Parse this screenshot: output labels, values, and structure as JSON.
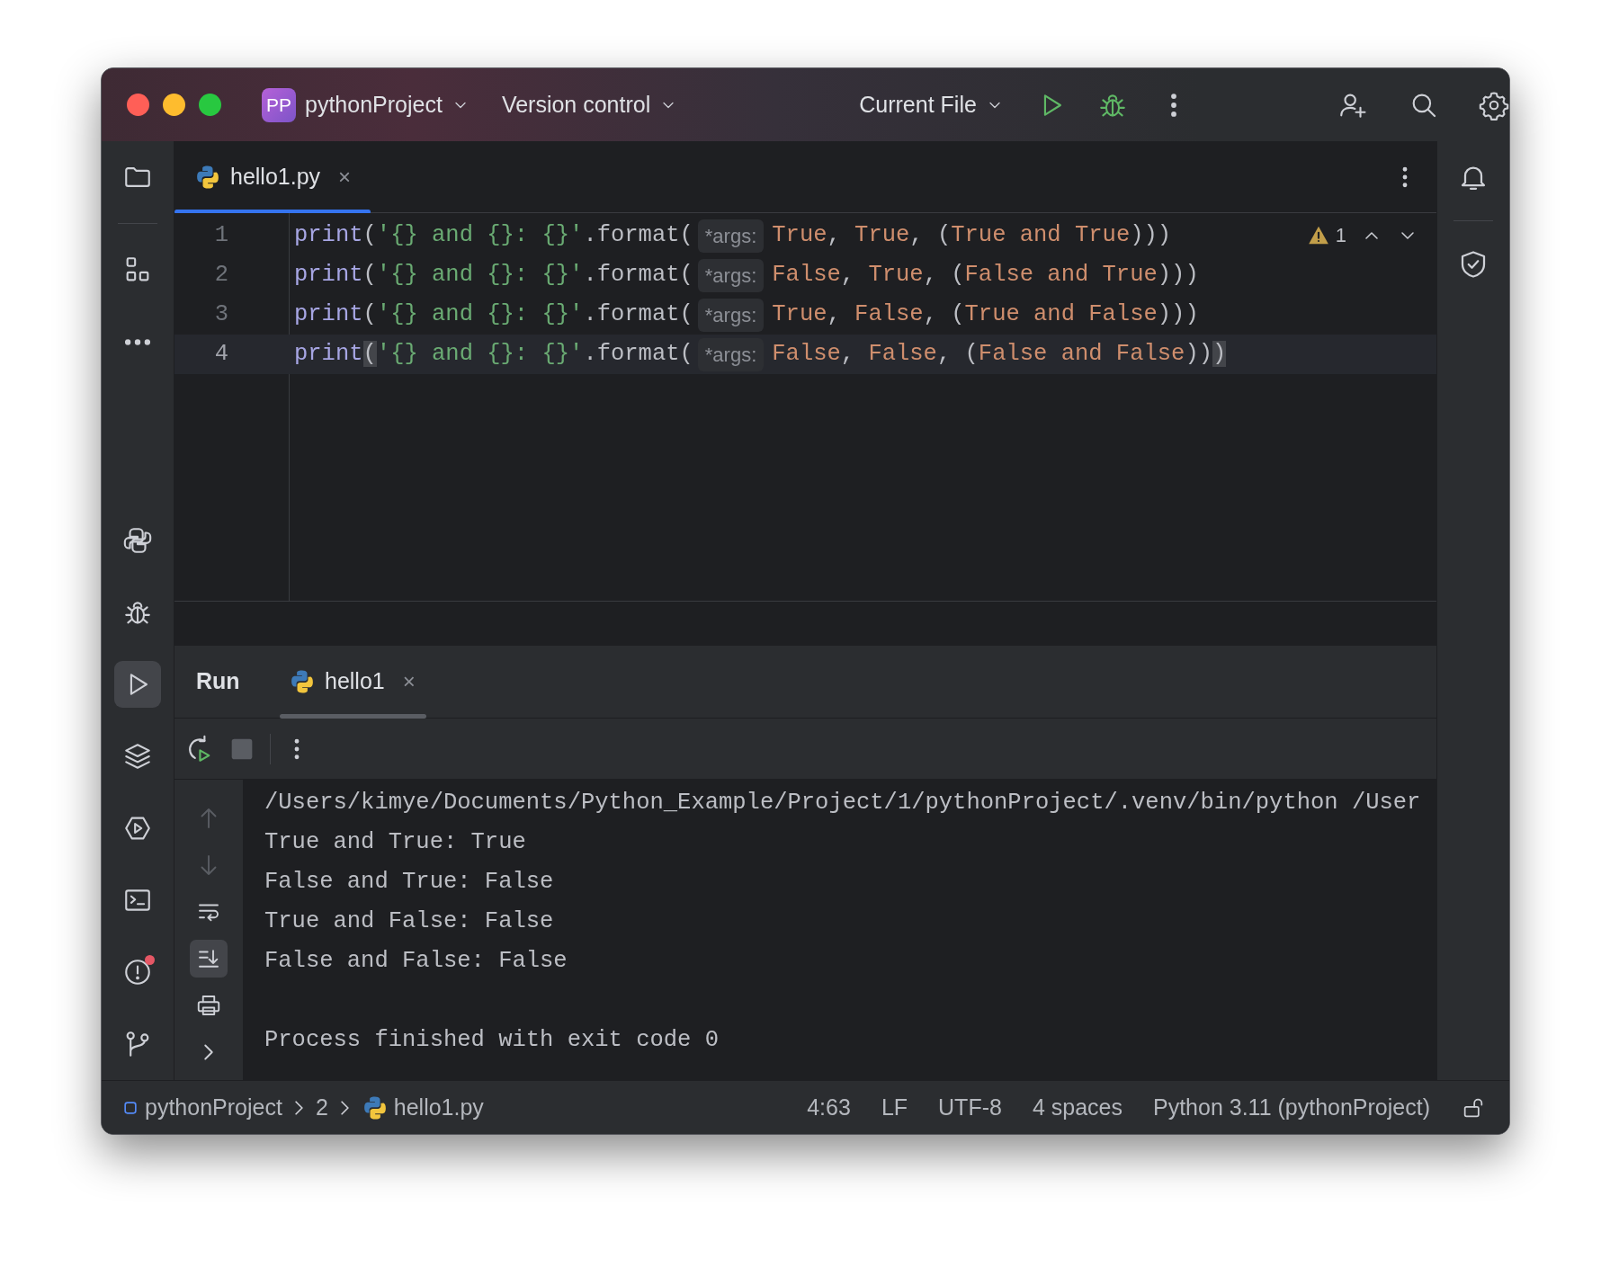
{
  "window": {
    "controls": [
      {
        "color": "#ff5f57"
      },
      {
        "color": "#febc2e"
      },
      {
        "color": "#28c840"
      }
    ]
  },
  "title_bar": {
    "project_badge": "PP",
    "project": "pythonProject",
    "vcs": "Version control",
    "run_config": "Current File"
  },
  "left_toolbar": {
    "top": [
      {
        "kind": "folder",
        "selected": false,
        "notification": false
      },
      {
        "kind": "structure",
        "selected": false,
        "notification": false
      },
      {
        "kind": "more",
        "selected": false,
        "notification": false
      }
    ],
    "bottom": [
      {
        "kind": "python",
        "selected": false,
        "notification": false
      },
      {
        "kind": "bug",
        "selected": false,
        "notification": false
      },
      {
        "kind": "run",
        "selected": true,
        "notification": false
      },
      {
        "kind": "layers",
        "selected": false,
        "notification": false
      },
      {
        "kind": "services",
        "selected": false,
        "notification": false
      },
      {
        "kind": "terminal",
        "selected": false,
        "notification": false
      },
      {
        "kind": "problems",
        "selected": false,
        "notification": true
      },
      {
        "kind": "branch",
        "selected": false,
        "notification": false
      }
    ]
  },
  "right_toolbar": [
    {
      "kind": "bell"
    },
    {
      "kind": "shield"
    }
  ],
  "editor": {
    "tabs": [
      {
        "title": "hello1.py",
        "selected": true,
        "close": "×"
      }
    ],
    "warnings": "1",
    "lines": [
      {
        "number": "1",
        "current": false,
        "tokens": [
          {
            "kind": "builtin",
            "text": "print"
          },
          {
            "kind": "plain",
            "text": "("
          },
          {
            "kind": "string",
            "text": "'{} and {}: {}'"
          },
          {
            "kind": "plain",
            "text": ".format("
          },
          {
            "kind": "hint",
            "text": "*args:"
          },
          {
            "kind": "keyword",
            "text": "True"
          },
          {
            "kind": "plain",
            "text": ", "
          },
          {
            "kind": "keyword",
            "text": "True"
          },
          {
            "kind": "plain",
            "text": ", ("
          },
          {
            "kind": "keyword",
            "text": "True and True"
          },
          {
            "kind": "plain",
            "text": ")))"
          }
        ]
      },
      {
        "number": "2",
        "current": false,
        "tokens": [
          {
            "kind": "builtin",
            "text": "print"
          },
          {
            "kind": "plain",
            "text": "("
          },
          {
            "kind": "string",
            "text": "'{} and {}: {}'"
          },
          {
            "kind": "plain",
            "text": ".format("
          },
          {
            "kind": "hint",
            "text": "*args:"
          },
          {
            "kind": "keyword",
            "text": "False"
          },
          {
            "kind": "plain",
            "text": ", "
          },
          {
            "kind": "keyword",
            "text": "True"
          },
          {
            "kind": "plain",
            "text": ", ("
          },
          {
            "kind": "keyword",
            "text": "False and True"
          },
          {
            "kind": "plain",
            "text": ")))"
          }
        ]
      },
      {
        "number": "3",
        "current": false,
        "tokens": [
          {
            "kind": "builtin",
            "text": "print"
          },
          {
            "kind": "plain",
            "text": "("
          },
          {
            "kind": "string",
            "text": "'{} and {}: {}'"
          },
          {
            "kind": "plain",
            "text": ".format("
          },
          {
            "kind": "hint",
            "text": "*args:"
          },
          {
            "kind": "keyword",
            "text": "True"
          },
          {
            "kind": "plain",
            "text": ", "
          },
          {
            "kind": "keyword",
            "text": "False"
          },
          {
            "kind": "plain",
            "text": ", ("
          },
          {
            "kind": "keyword",
            "text": "True and False"
          },
          {
            "kind": "plain",
            "text": ")))"
          }
        ]
      },
      {
        "number": "4",
        "current": true,
        "tokens": [
          {
            "kind": "builtin",
            "text": "print"
          },
          {
            "kind": "match",
            "text": "("
          },
          {
            "kind": "string",
            "text": "'{} and {}: {}'"
          },
          {
            "kind": "plain",
            "text": ".format("
          },
          {
            "kind": "hint",
            "text": "*args:"
          },
          {
            "kind": "keyword",
            "text": "False"
          },
          {
            "kind": "plain",
            "text": ", "
          },
          {
            "kind": "keyword",
            "text": "False"
          },
          {
            "kind": "plain",
            "text": ", ("
          },
          {
            "kind": "keyword",
            "text": "False and False"
          },
          {
            "kind": "plain",
            "text": "))"
          },
          {
            "kind": "match",
            "text": ")"
          }
        ]
      }
    ]
  },
  "run_panel": {
    "title": "Run",
    "tabs": [
      {
        "title": "hello1",
        "selected": true,
        "close": "×"
      }
    ],
    "toolbar": {
      "stop_disabled": true
    },
    "side_buttons": [
      {
        "kind": "up",
        "disabled": true,
        "on": false
      },
      {
        "kind": "down",
        "disabled": true,
        "on": false
      },
      {
        "kind": "wrap",
        "disabled": false,
        "on": false
      },
      {
        "kind": "scroll_end",
        "disabled": false,
        "on": true
      },
      {
        "kind": "print",
        "disabled": false,
        "on": false
      },
      {
        "kind": "expand",
        "disabled": false,
        "on": false
      }
    ],
    "output": [
      "/Users/kimye/Documents/Python_Example/Project/1/pythonProject/.venv/bin/python /User",
      "True and True: True",
      "False and True: False",
      "True and False: False",
      "False and False: False"
    ],
    "exit_message": "Process finished with exit code 0"
  },
  "status_bar": {
    "breadcrumbs": [
      {
        "kind": "project",
        "text": "pythonProject"
      },
      {
        "kind": "folder",
        "text": "2"
      },
      {
        "kind": "python_file",
        "text": "hello1.py"
      }
    ],
    "position": "4:63",
    "line_separator": "LF",
    "encoding": "UTF-8",
    "indent": "4 spaces",
    "interpreter": "Python 3.11 (pythonProject)",
    "read_only": false
  }
}
